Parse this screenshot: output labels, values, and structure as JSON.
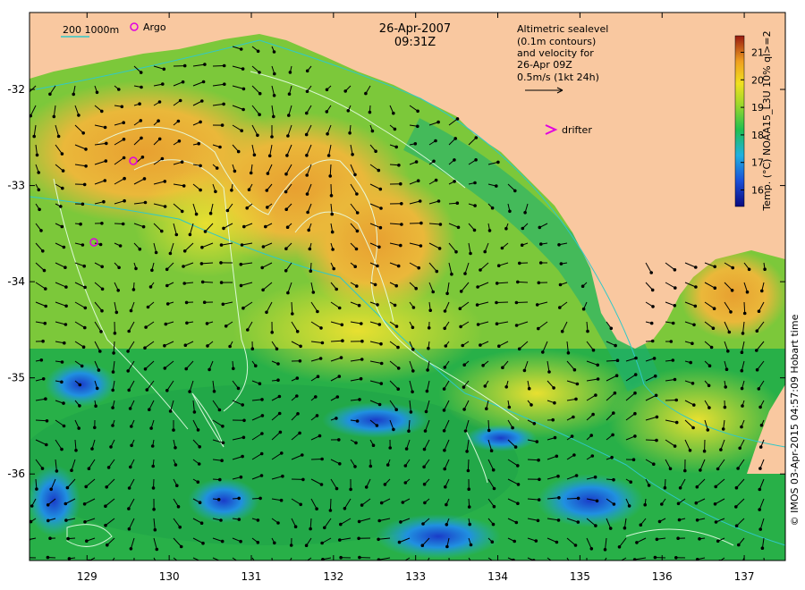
{
  "title": {
    "date": "26-Apr-2007",
    "time": "09:31Z"
  },
  "legend": {
    "isobath_label": "200  1000m",
    "argo_label": "Argo",
    "drifter_label": "drifter",
    "altimetry_lines": [
      "Altimetric sealevel",
      "(0.1m contours)",
      "and velocity for",
      "26-Apr 09Z",
      "0.5m/s (1kt 24h)"
    ]
  },
  "colorbar": {
    "label": "Temp. (°C) NOAA15_L3U 10% ql>=2",
    "ticks": [
      "16",
      "17",
      "18",
      "19",
      "20",
      "21"
    ],
    "min": 15.4,
    "max": 21.6
  },
  "axes": {
    "lon": {
      "ticks": [
        "129",
        "130",
        "131",
        "132",
        "133",
        "134",
        "135",
        "136",
        "137"
      ],
      "min": 128.3,
      "max": 137.5
    },
    "lat": {
      "ticks": [
        "-32",
        "-33",
        "-34",
        "-35",
        "-36"
      ],
      "min": -36.9,
      "max": -31.2
    }
  },
  "credit": "© IMOS 03-Apr-2015 04:57:09 Hobart time",
  "colors": {
    "land": "#f9c8a0",
    "warm": "#e8a030",
    "mid": "#b8dc2a",
    "cool": "#2ab040",
    "cold": "#1a3cc8",
    "argo": "#e000e0",
    "drifter": "#e000e0",
    "isobath": "#30c8c8"
  }
}
